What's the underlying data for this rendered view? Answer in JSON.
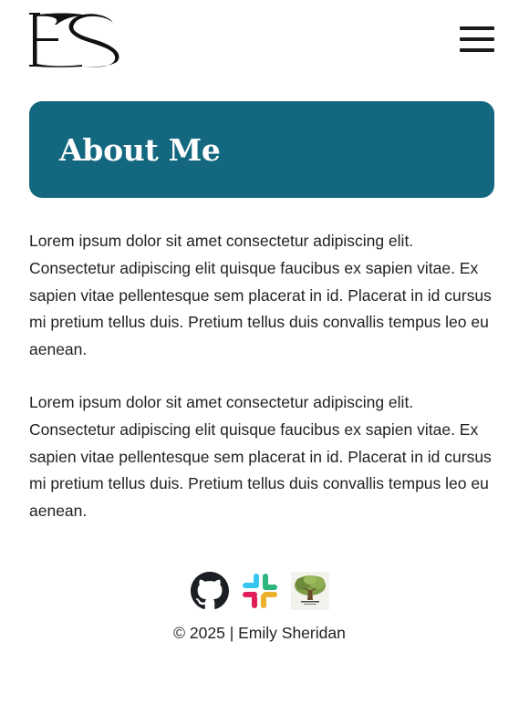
{
  "header": {
    "logo_text": "ES",
    "menu_label": "Menu"
  },
  "hero": {
    "title": "About Me",
    "color": "#136880"
  },
  "content": {
    "paragraphs": [
      "Lorem ipsum dolor sit amet consectetur adipiscing elit. Consectetur adipiscing elit quisque faucibus ex sapien vitae. Ex sapien vitae pellentesque sem placerat in id. Placerat in id cursus mi pretium tellus duis. Pretium tellus duis convallis tempus leo eu aenean.",
      "Lorem ipsum dolor sit amet consectetur adipiscing elit. Consectetur adipiscing elit quisque faucibus ex sapien vitae. Ex sapien vitae pellentesque sem placerat in id. Placerat in id cursus mi pretium tellus duis. Pretium tellus duis convallis tempus leo eu aenean."
    ]
  },
  "footer": {
    "socials": [
      {
        "icon": "github-icon"
      },
      {
        "icon": "slack-icon"
      },
      {
        "icon": "tree-logo-icon"
      }
    ],
    "copyright": "© 2025 | Emily Sheridan"
  },
  "colors": {
    "accent": "#136880",
    "text": "#222222",
    "background": "#ffffff"
  }
}
